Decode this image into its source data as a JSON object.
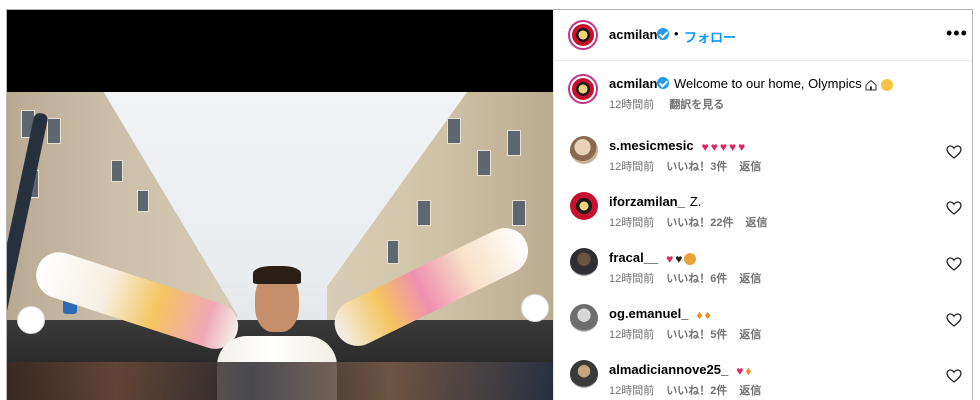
{
  "post": {
    "account": "acmilan",
    "follow_label": "フォロー",
    "separator": "•",
    "more_label": "•••",
    "caption": {
      "username": "acmilan",
      "text": "Welcome to our home, Olympics",
      "emoji_icons": [
        "house-icon",
        "smiling-face-icon"
      ],
      "time": "12時間前",
      "translate_label": "翻訳を見る"
    },
    "comments": [
      {
        "username": "s.mesicmesic",
        "text": "",
        "emoji_icons": [
          "red-heart-icon",
          "red-heart-icon",
          "red-heart-icon",
          "red-heart-icon",
          "red-heart-icon"
        ],
        "time": "12時間前",
        "likes": "いいね！3件",
        "reply_label": "返信"
      },
      {
        "username": "iforzamilan_",
        "text": "Z.",
        "emoji_icons": [],
        "time": "12時間前",
        "likes": "いいね！22件",
        "reply_label": "返信"
      },
      {
        "username": "fracal__",
        "text": "",
        "emoji_icons": [
          "red-heart-icon",
          "black-heart-icon",
          "lion-face-icon"
        ],
        "time": "12時間前",
        "likes": "いいね！6件",
        "reply_label": "返信"
      },
      {
        "username": "og.emanuel_",
        "text": "",
        "emoji_icons": [
          "fire-icon",
          "fire-icon"
        ],
        "time": "12時間前",
        "likes": "いいね！5件",
        "reply_label": "返信"
      },
      {
        "username": "almadiciannove25_",
        "text": "",
        "emoji_icons": [
          "red-heart-icon",
          "fire-icon"
        ],
        "time": "12時間前",
        "likes": "いいね！2件",
        "reply_label": "返信"
      }
    ]
  },
  "colors": {
    "link_blue": "#0095f6",
    "muted_gray": "#737373",
    "verified_blue": "#1d9bf0",
    "story_ring": "#c13584"
  }
}
